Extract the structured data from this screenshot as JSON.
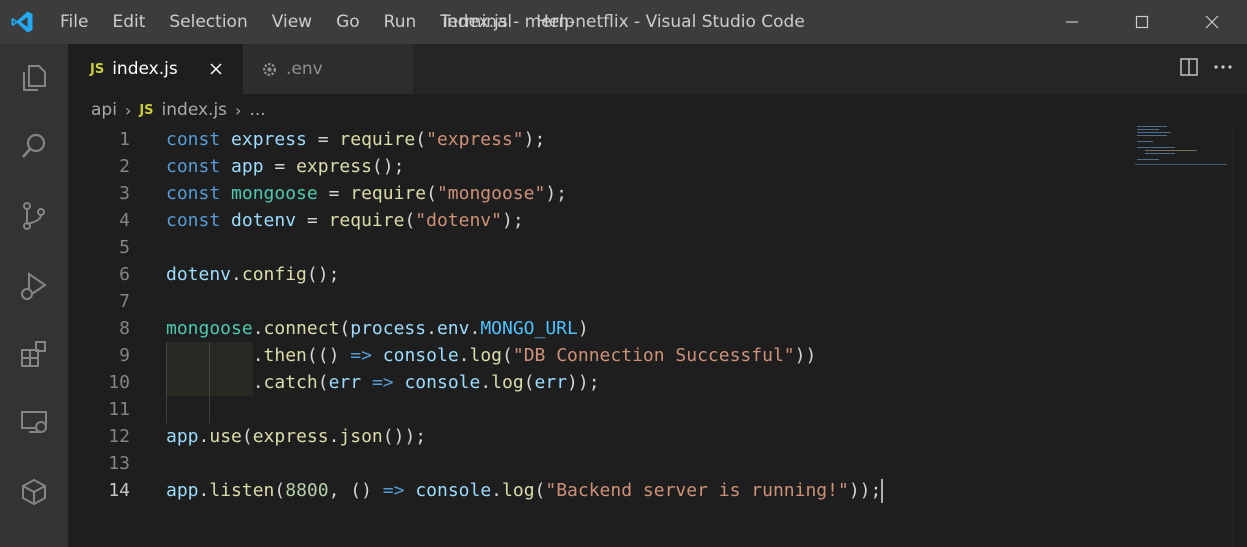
{
  "titlebar": {
    "menu": [
      "File",
      "Edit",
      "Selection",
      "View",
      "Go",
      "Run",
      "Terminal",
      "Help"
    ],
    "window_title": "index.js - mern-netflix - Visual Studio Code"
  },
  "activitybar": {
    "icons": [
      "explorer-icon",
      "search-icon",
      "source-control-icon",
      "run-debug-icon",
      "extensions-icon",
      "remote-explorer-icon",
      "docker-icon"
    ]
  },
  "tabs": [
    {
      "badge": "JS",
      "label": "index.js",
      "active": true
    },
    {
      "icon": "gear-icon",
      "label": ".env",
      "active": false
    }
  ],
  "breadcrumb": {
    "folder": "api",
    "file_badge": "JS",
    "file": "index.js",
    "more": "..."
  },
  "editor": {
    "active_line": 14,
    "lines": [
      {
        "n": "1",
        "tokens": [
          [
            "kw",
            "const"
          ],
          [
            "pl",
            " "
          ],
          [
            "var",
            "express"
          ],
          [
            "pl",
            " = "
          ],
          [
            "fn",
            "require"
          ],
          [
            "pl",
            "("
          ],
          [
            "str",
            "\"express\""
          ],
          [
            "pl",
            ");"
          ]
        ]
      },
      {
        "n": "2",
        "tokens": [
          [
            "kw",
            "const"
          ],
          [
            "pl",
            " "
          ],
          [
            "var",
            "app"
          ],
          [
            "pl",
            " = "
          ],
          [
            "fn",
            "express"
          ],
          [
            "pl",
            "();"
          ]
        ]
      },
      {
        "n": "3",
        "tokens": [
          [
            "kw",
            "const"
          ],
          [
            "pl",
            " "
          ],
          [
            "obj",
            "mongoose"
          ],
          [
            "pl",
            " = "
          ],
          [
            "fn",
            "require"
          ],
          [
            "pl",
            "("
          ],
          [
            "str",
            "\"mongoose\""
          ],
          [
            "pl",
            ");"
          ]
        ]
      },
      {
        "n": "4",
        "tokens": [
          [
            "kw",
            "const"
          ],
          [
            "pl",
            " "
          ],
          [
            "var",
            "dotenv"
          ],
          [
            "pl",
            " = "
          ],
          [
            "fn",
            "require"
          ],
          [
            "pl",
            "("
          ],
          [
            "str",
            "\"dotenv\""
          ],
          [
            "pl",
            ");"
          ]
        ]
      },
      {
        "n": "5",
        "tokens": []
      },
      {
        "n": "6",
        "tokens": [
          [
            "var",
            "dotenv"
          ],
          [
            "pl",
            "."
          ],
          [
            "fn",
            "config"
          ],
          [
            "pl",
            "();"
          ]
        ]
      },
      {
        "n": "7",
        "tokens": []
      },
      {
        "n": "8",
        "tokens": [
          [
            "obj",
            "mongoose"
          ],
          [
            "pl",
            "."
          ],
          [
            "fn",
            "connect"
          ],
          [
            "pl",
            "("
          ],
          [
            "var",
            "process"
          ],
          [
            "pl",
            "."
          ],
          [
            "var",
            "env"
          ],
          [
            "pl",
            "."
          ],
          [
            "cst",
            "MONGO_URL"
          ],
          [
            "pl",
            ")"
          ]
        ]
      },
      {
        "n": "9",
        "tokens": [
          [
            "pl",
            "        ."
          ],
          [
            "fn",
            "then"
          ],
          [
            "pl",
            "(() "
          ],
          [
            "kw",
            "=>"
          ],
          [
            "pl",
            " "
          ],
          [
            "var",
            "console"
          ],
          [
            "pl",
            "."
          ],
          [
            "fn",
            "log"
          ],
          [
            "pl",
            "("
          ],
          [
            "str",
            "\"DB Connection Successful\""
          ],
          [
            "pl",
            "))"
          ]
        ]
      },
      {
        "n": "10",
        "tokens": [
          [
            "pl",
            "        ."
          ],
          [
            "fn",
            "catch"
          ],
          [
            "pl",
            "("
          ],
          [
            "var",
            "err"
          ],
          [
            "pl",
            " "
          ],
          [
            "kw",
            "=>"
          ],
          [
            "pl",
            " "
          ],
          [
            "var",
            "console"
          ],
          [
            "pl",
            "."
          ],
          [
            "fn",
            "log"
          ],
          [
            "pl",
            "("
          ],
          [
            "var",
            "err"
          ],
          [
            "pl",
            "));"
          ]
        ]
      },
      {
        "n": "11",
        "tokens": []
      },
      {
        "n": "12",
        "tokens": [
          [
            "var",
            "app"
          ],
          [
            "pl",
            "."
          ],
          [
            "fn",
            "use"
          ],
          [
            "pl",
            "("
          ],
          [
            "fn",
            "express"
          ],
          [
            "pl",
            "."
          ],
          [
            "fn",
            "json"
          ],
          [
            "pl",
            "());"
          ]
        ]
      },
      {
        "n": "13",
        "tokens": []
      },
      {
        "n": "14",
        "tokens": [
          [
            "var",
            "app"
          ],
          [
            "pl",
            "."
          ],
          [
            "fn",
            "listen"
          ],
          [
            "pl",
            "("
          ],
          [
            "num",
            "8800"
          ],
          [
            "pl",
            ", () "
          ],
          [
            "kw",
            "=>"
          ],
          [
            "pl",
            " "
          ],
          [
            "var",
            "console"
          ],
          [
            "pl",
            "."
          ],
          [
            "fn",
            "log"
          ],
          [
            "pl",
            "("
          ],
          [
            "str",
            "\"Backend server is running!\""
          ],
          [
            "pl",
            "));"
          ]
        ]
      }
    ]
  },
  "colors": {
    "titlebar_bg": "#3c3c3c",
    "activitybar_bg": "#333333",
    "editor_bg": "#1e1e1e",
    "tab_inactive_bg": "#2d2d2d",
    "vscode_blue": "#23a9f2",
    "js_badge": "#cbcb41"
  }
}
